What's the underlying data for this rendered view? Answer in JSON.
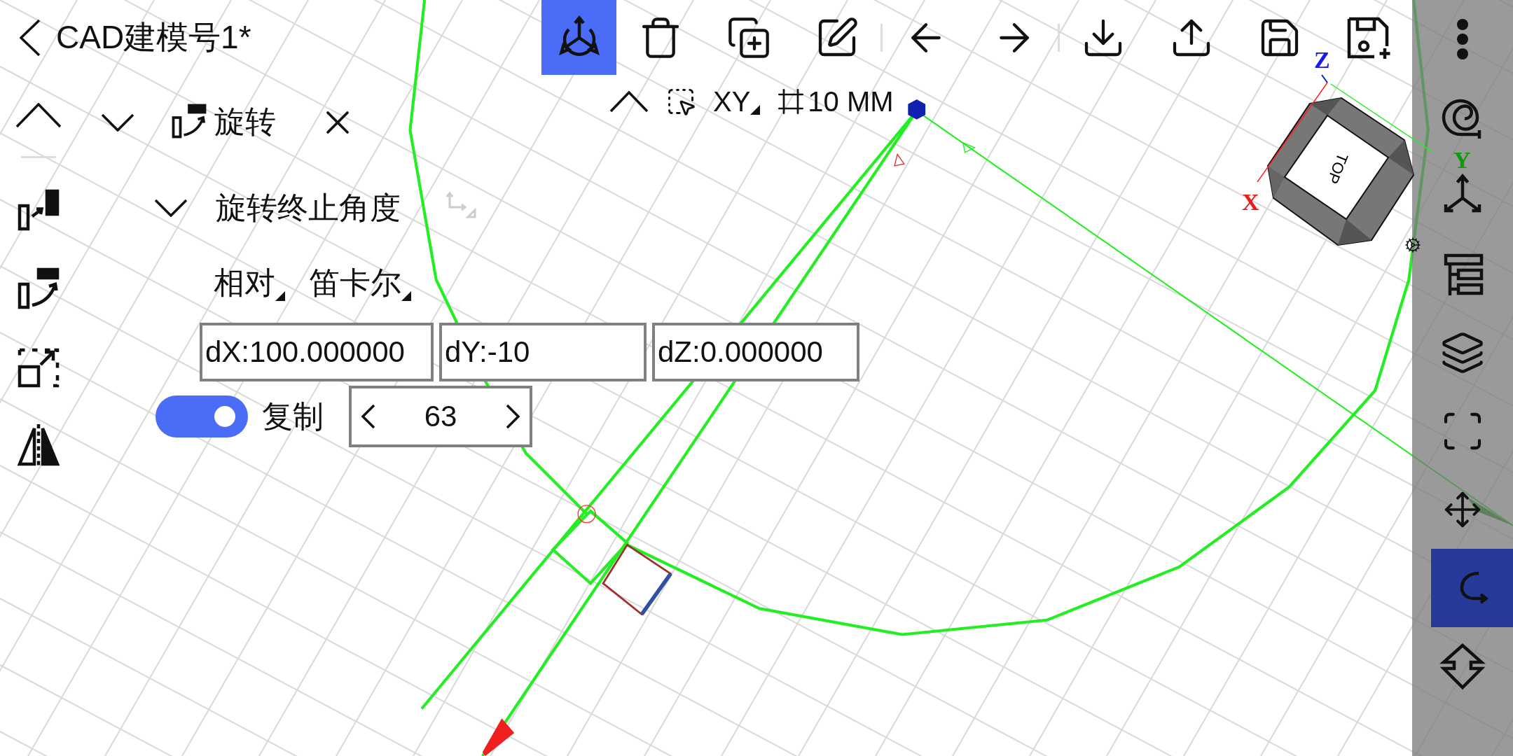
{
  "title": "CAD建模号1*",
  "toolbar": [
    {
      "selected": true
    },
    {
      "selected": false
    },
    {
      "selected": false
    },
    {
      "selected": false
    },
    {
      "selected": false
    },
    {
      "selected": false
    },
    {
      "selected": false
    },
    {
      "selected": false
    },
    {
      "selected": false
    },
    {
      "selected": false
    }
  ],
  "view_bar": {
    "plane": "XY",
    "grid": "10 MM"
  },
  "command": {
    "title": "旋转",
    "step": "旋转终止角度",
    "mode": "相对",
    "coords": "笛卡尔",
    "fields": [
      {
        "value": "dX:100.000000"
      },
      {
        "value": "dY:-10"
      },
      {
        "value": "dZ:0.000000"
      }
    ],
    "copy": {
      "label": "复制",
      "on": true
    },
    "count": "63"
  },
  "view_cube": {
    "face": "TOP",
    "x": "X",
    "y": "Y",
    "z": "Z"
  },
  "sidebar": [
    {
      "selected": false
    },
    {
      "selected": false
    },
    {
      "selected": false
    },
    {
      "selected": false
    },
    {
      "selected": false
    },
    {
      "selected": false
    },
    {
      "selected": false
    },
    {
      "selected": true
    },
    {
      "selected": false
    }
  ]
}
